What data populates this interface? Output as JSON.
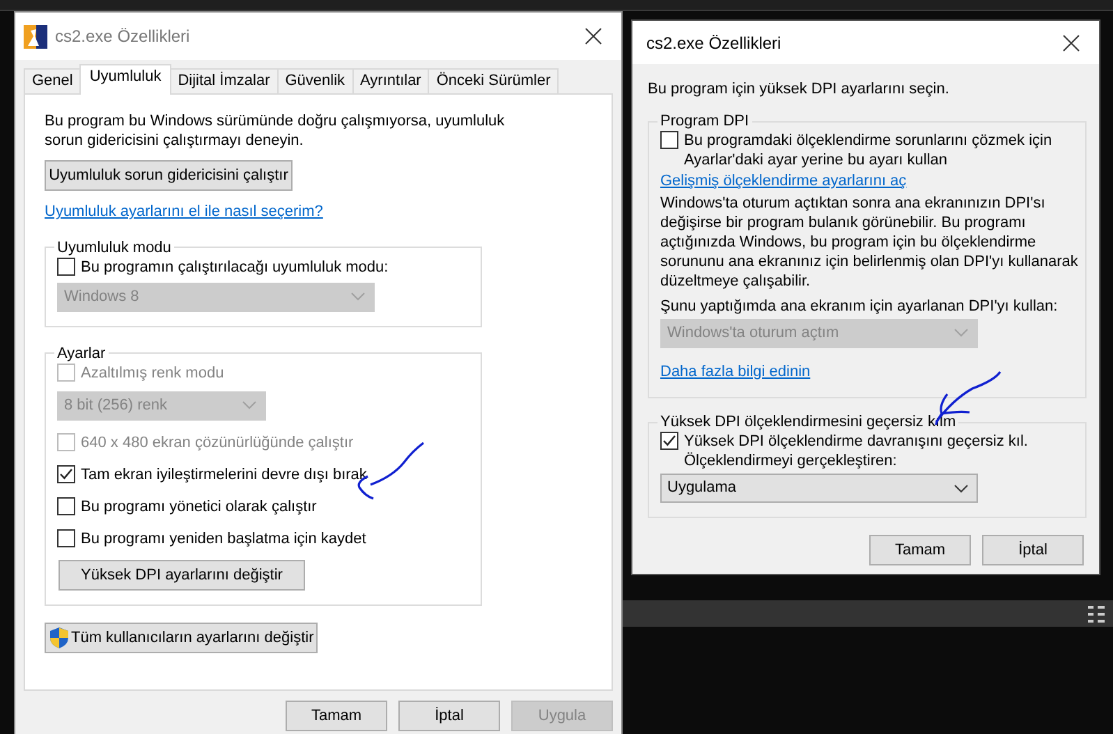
{
  "compat_dialog": {
    "title": "cs2.exe Özellikleri",
    "tabs": [
      {
        "label": "Genel",
        "selected": false
      },
      {
        "label": "Uyumluluk",
        "selected": true
      },
      {
        "label": "Dijital İmzalar",
        "selected": false
      },
      {
        "label": "Güvenlik",
        "selected": false
      },
      {
        "label": "Ayrıntılar",
        "selected": false
      },
      {
        "label": "Önceki Sürümler",
        "selected": false
      }
    ],
    "intro_lines": [
      "Bu program bu Windows sürümünde doğru çalışmıyorsa, uyumluluk",
      "sorun gidericisini çalıştırmayı deneyin."
    ],
    "troubleshoot_button": "Uyumluluk sorun gidericisini çalıştır",
    "help_link": "Uyumluluk ayarlarını el ile nasıl seçerim?",
    "compat_mode": {
      "legend": "Uyumluluk modu",
      "checkbox": {
        "label": "Bu programın çalıştırılacağı uyumluluk modu:",
        "checked": false,
        "disabled": false
      },
      "select": {
        "value": "Windows 8",
        "disabled": true
      }
    },
    "settings": {
      "legend": "Ayarlar",
      "items": [
        {
          "kind": "checkbox",
          "label": "Azaltılmış renk modu",
          "checked": false,
          "disabled": true
        },
        {
          "kind": "select",
          "value": "8 bit (256) renk",
          "disabled": true
        },
        {
          "kind": "checkbox",
          "label": "640 x 480 ekran çözünürlüğünde çalıştır",
          "checked": false,
          "disabled": true
        },
        {
          "kind": "checkbox",
          "label": "Tam ekran iyileştirmelerini devre dışı bırak",
          "checked": true,
          "disabled": false
        },
        {
          "kind": "checkbox",
          "label": "Bu programı yönetici olarak çalıştır",
          "checked": false,
          "disabled": false
        },
        {
          "kind": "checkbox",
          "label": "Bu programı yeniden başlatma için kaydet",
          "checked": false,
          "disabled": false
        },
        {
          "kind": "button",
          "label": "Yüksek DPI ayarlarını değiştir",
          "disabled": false
        }
      ]
    },
    "all_users_button": "Tüm kullanıcıların ayarlarını değiştir",
    "buttons": [
      {
        "label": "Tamam",
        "disabled": false
      },
      {
        "label": "İptal",
        "disabled": false
      },
      {
        "label": "Uygula",
        "disabled": true
      }
    ]
  },
  "dpi_dialog": {
    "title": "cs2.exe Özellikleri",
    "intro": "Bu program için yüksek DPI ayarlarını seçin.",
    "program_dpi": {
      "legend": "Program DPI",
      "checkbox": {
        "label_lines": [
          "Bu programdaki ölçeklendirme sorunlarını çözmek için",
          "Ayarlar'daki ayar yerine bu ayarı kullan"
        ],
        "checked": false
      },
      "link": "Gelişmiş ölçeklendirme ayarlarını aç",
      "description_lines": [
        "Windows'ta oturum açtıktan sonra ana ekranınızın DPI'sı",
        "değişirse bir program bulanık görünebilir. Bu programı",
        "açtığınızda Windows, bu program için bu ölçeklendirme",
        "sorununu ana ekranınız için belirlenmiş olan DPI'yı kullanarak",
        "düzeltmeye çalışabilir."
      ],
      "select_label": "Şunu yaptığımda ana ekranım için ayarlanan DPI'yı kullan:",
      "select": {
        "value": "Windows'ta oturum açtım",
        "disabled": true
      },
      "more_link": "Daha fazla bilgi edinin"
    },
    "override": {
      "legend": "Yüksek DPI ölçeklendirmesini geçersiz kılm",
      "checkbox": {
        "label_lines": [
          "Yüksek DPI ölçeklendirme davranışını geçersiz kıl.",
          "Ölçeklendirmeyi gerçekleştiren:"
        ],
        "checked": true
      },
      "select": {
        "value": "Uygulama",
        "disabled": false
      }
    },
    "buttons": [
      {
        "label": "Tamam",
        "disabled": false
      },
      {
        "label": "İptal",
        "disabled": false
      }
    ]
  }
}
